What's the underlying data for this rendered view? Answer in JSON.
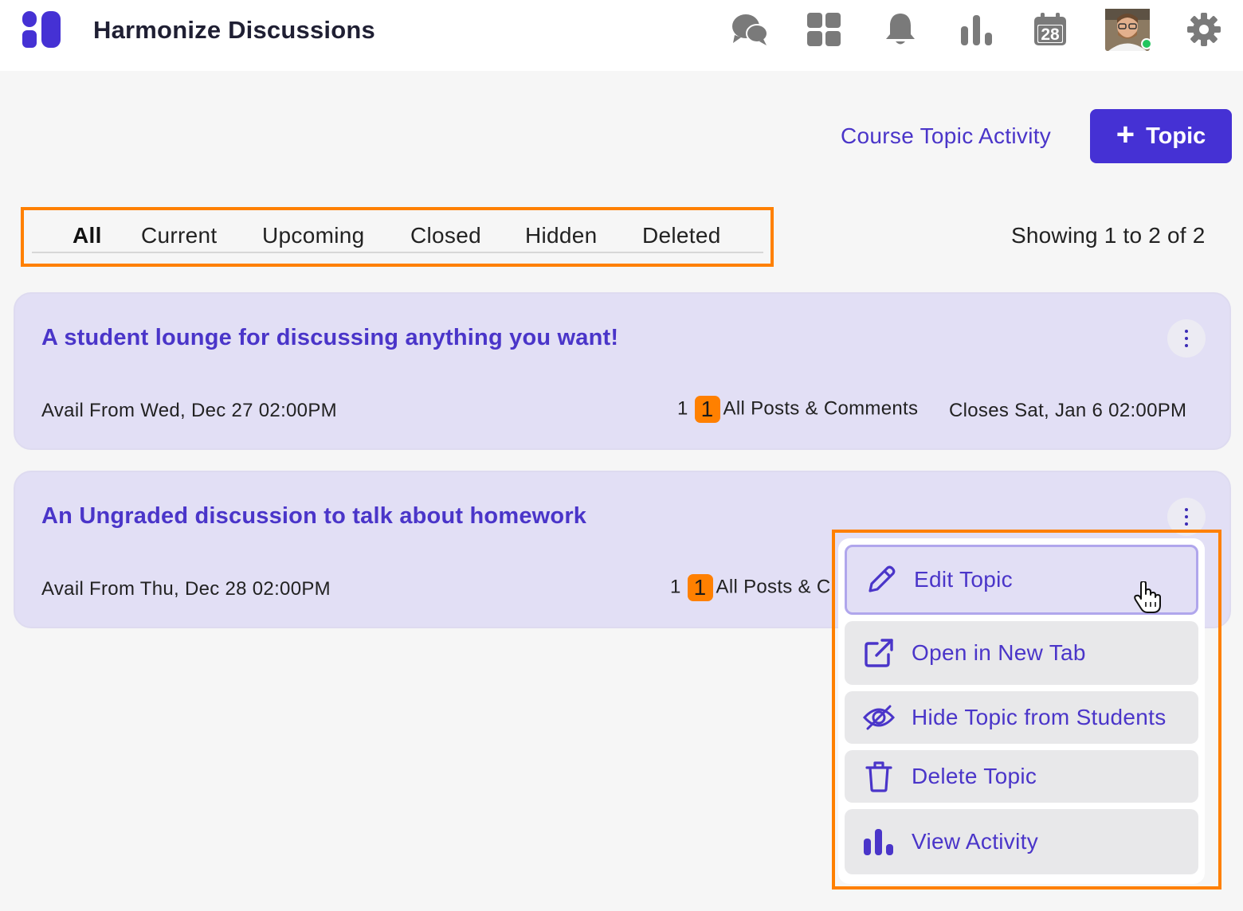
{
  "header": {
    "app_title": "Harmonize Discussions",
    "icons": [
      "chat-icon",
      "dashboard-icon",
      "bell-icon",
      "bar-chart-icon",
      "calendar-icon",
      "avatar",
      "gear-icon"
    ],
    "calendar_day": "28"
  },
  "actions": {
    "activity_link": "Course Topic Activity",
    "add_topic_label": "Topic"
  },
  "tabs": [
    {
      "label": "All",
      "active": true
    },
    {
      "label": "Current",
      "active": false
    },
    {
      "label": "Upcoming",
      "active": false
    },
    {
      "label": "Closed",
      "active": false
    },
    {
      "label": "Hidden",
      "active": false
    },
    {
      "label": "Deleted",
      "active": false
    }
  ],
  "showing": "Showing 1 to 2 of 2",
  "topics": [
    {
      "title": "A student lounge for discussing anything you want!",
      "avail": "Avail From Wed, Dec 27 02:00PM",
      "posts_count": "1",
      "new_count": "1",
      "posts_label": "All Posts & Comments",
      "closes": "Closes Sat, Jan 6 02:00PM"
    },
    {
      "title": "An Ungraded discussion to talk about homework",
      "avail": "Avail From Thu, Dec 28 02:00PM",
      "posts_count": "1",
      "new_count": "1",
      "posts_label": "All Posts & C"
    }
  ],
  "menu": [
    {
      "label": "Edit Topic",
      "icon": "pencil-icon"
    },
    {
      "label": "Open in New Tab",
      "icon": "external-link-icon"
    },
    {
      "label": "Hide Topic from Students",
      "icon": "eye-slash-icon"
    },
    {
      "label": "Delete Topic",
      "icon": "trash-icon"
    },
    {
      "label": "View Activity",
      "icon": "bar-chart-icon"
    }
  ],
  "colors": {
    "accent": "#4531d4",
    "link": "#4a35c9",
    "highlight": "#ff8000",
    "card_bg": "#e2dff5",
    "icon_gray": "#7a7a7a"
  }
}
